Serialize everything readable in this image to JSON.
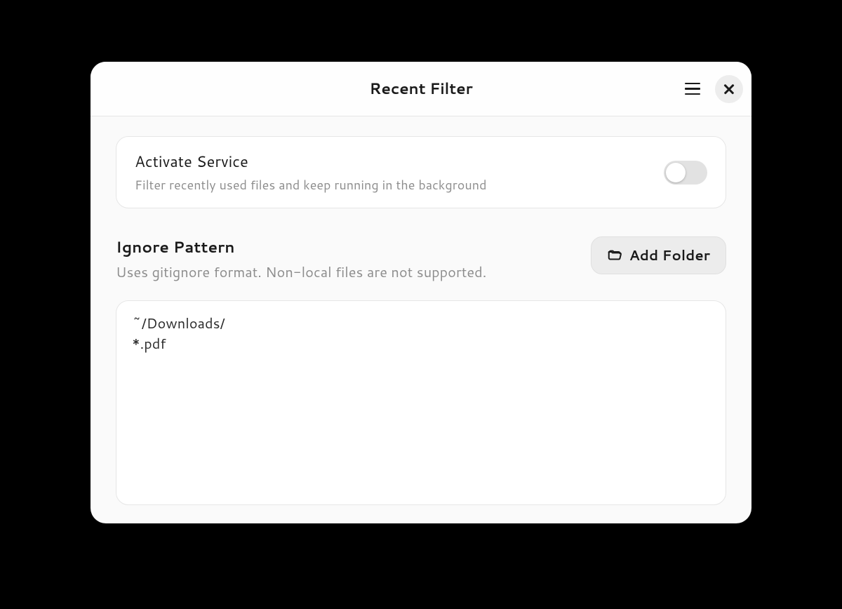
{
  "header": {
    "title": "Recent Filter"
  },
  "activate": {
    "title": "Activate Service",
    "subtitle": "Filter recently used files and keep running in the background",
    "enabled": false
  },
  "ignore": {
    "title": "Ignore Pattern",
    "subtitle": "Uses gitignore format. Non-local files are not supported.",
    "add_folder_label": "Add Folder",
    "pattern_text": "~/Downloads/\n*.pdf"
  }
}
